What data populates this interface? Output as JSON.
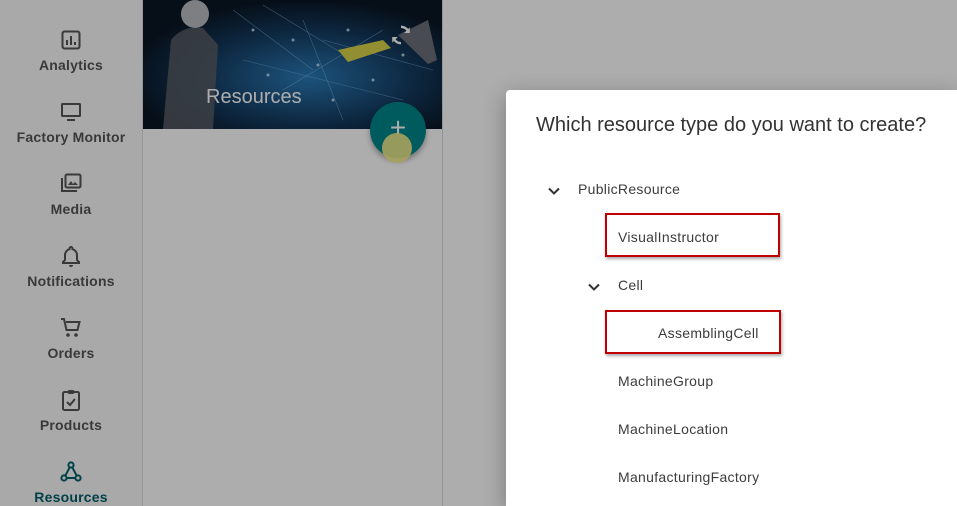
{
  "sidebar": {
    "items": [
      {
        "label": "Analytics",
        "icon": "analytics-icon"
      },
      {
        "label": "Factory Monitor",
        "icon": "monitor-icon"
      },
      {
        "label": "Media",
        "icon": "media-icon"
      },
      {
        "label": "Notifications",
        "icon": "bell-icon"
      },
      {
        "label": "Orders",
        "icon": "cart-icon"
      },
      {
        "label": "Products",
        "icon": "clipboard-check-icon"
      },
      {
        "label": "Resources",
        "icon": "resources-network-icon",
        "active": true
      }
    ]
  },
  "banner": {
    "title": "Resources"
  },
  "fab": {
    "label": "+"
  },
  "dialog": {
    "title": "Which resource type do you want to create?",
    "tree": [
      {
        "label": "PublicResource",
        "expanded": true
      },
      {
        "label": "VisualInstructor",
        "highlighted": true
      },
      {
        "label": "Cell",
        "expanded": true
      },
      {
        "label": "AssemblingCell",
        "highlighted": true
      },
      {
        "label": "MachineGroup"
      },
      {
        "label": "MachineLocation"
      },
      {
        "label": "ManufacturingFactory"
      }
    ]
  },
  "colors": {
    "accent": "#00868c",
    "active_nav": "#005f6b",
    "highlight_border": "#c00000"
  }
}
